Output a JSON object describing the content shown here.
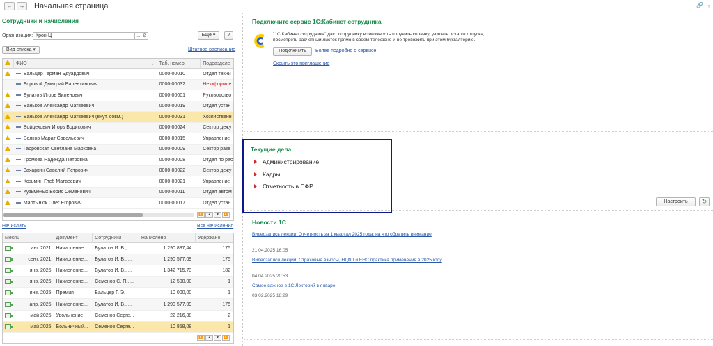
{
  "window": {
    "title": "Начальная страница",
    "back_icon": "arrow-left",
    "forward_icon": "arrow-right"
  },
  "employees": {
    "section_title": "Сотрудники и начисления",
    "org_label": "Организация:",
    "org_value": "Крон-Ц",
    "more_label": "Еще",
    "help_label": "?",
    "view_list_label": "Вид списка",
    "staff_schedule_link": "Штатное расписание",
    "columns": [
      "ФИО",
      "Таб. номер",
      "Подразделе"
    ],
    "rows": [
      {
        "name": "Бальцер Герман Эдуардович",
        "num": "0000-00010",
        "dept": "Отдел техни",
        "warn": true,
        "dept_red": false,
        "selected": false
      },
      {
        "name": "Боровой Дмитрий Валентинович",
        "num": "0000-00032",
        "dept": "Не оформле",
        "warn": false,
        "dept_red": true,
        "selected": false
      },
      {
        "name": "Булатов Игорь Виленович",
        "num": "0000-00001",
        "dept": "Руководство",
        "warn": true,
        "dept_red": false,
        "selected": false
      },
      {
        "name": "Ваньков Александр Матвеевич",
        "num": "0000-00019",
        "dept": "Отдел устан",
        "warn": true,
        "dept_red": false,
        "selected": false
      },
      {
        "name": "Ваньков Александр Матвеевич (внут. совм.)",
        "num": "0000-00031",
        "dept": "Хозяйственн",
        "warn": true,
        "dept_red": false,
        "selected": true
      },
      {
        "name": "Войцехович Игорь Борисович",
        "num": "0000-00024",
        "dept": "Сектор дежу",
        "warn": true,
        "dept_red": false,
        "selected": false
      },
      {
        "name": "Волков Марат Савельевич",
        "num": "0000-00015",
        "dept": "Управление",
        "warn": true,
        "dept_red": false,
        "selected": false
      },
      {
        "name": "Габровская Светлана Марковна",
        "num": "0000-00009",
        "dept": "Сектор разв",
        "warn": true,
        "dept_red": false,
        "selected": false
      },
      {
        "name": "Громова Надежда Петровна",
        "num": "0000-00008",
        "dept": "Отдел по раб",
        "warn": true,
        "dept_red": false,
        "selected": false
      },
      {
        "name": "Захаркин Савелий Петрович",
        "num": "0000-00022",
        "dept": "Сектор дежу",
        "warn": true,
        "dept_red": false,
        "selected": false
      },
      {
        "name": "Козьмин Глеб Матвеевич",
        "num": "0000-00021",
        "dept": "Управление",
        "warn": true,
        "dept_red": false,
        "selected": false
      },
      {
        "name": "Кузьменых Борис Семенович",
        "num": "0000-00011",
        "dept": "Отдел автом",
        "warn": true,
        "dept_red": false,
        "selected": false
      },
      {
        "name": "Мартынюк Олег Егорович",
        "num": "0000-00017",
        "dept": "Отдел устан",
        "warn": true,
        "dept_red": false,
        "selected": false
      }
    ]
  },
  "accruals": {
    "calc_link": "Начислить",
    "all_link": "Все начисления",
    "columns": [
      "Месяц",
      "Документ",
      "Сотрудники",
      "Начислено",
      "Удержано"
    ],
    "rows": [
      {
        "month": "авг. 2021",
        "doc": "Начисление...",
        "emp": "Булатов И. В., ...",
        "acc": "1 290 887,44",
        "ded": "175",
        "selected": false
      },
      {
        "month": "сент. 2021",
        "doc": "Начисление...",
        "emp": "Булатов И. В., ...",
        "acc": "1 290 577,09",
        "ded": "175",
        "selected": false
      },
      {
        "month": "янв. 2025",
        "doc": "Начисление...",
        "emp": "Булатов И. В., ...",
        "acc": "1 342 715,73",
        "ded": "182",
        "selected": false
      },
      {
        "month": "янв. 2025",
        "doc": "Начисление...",
        "emp": "Семенов С. П., ...",
        "acc": "12 500,00",
        "ded": "1",
        "selected": false
      },
      {
        "month": "янв. 2025",
        "doc": "Премия",
        "emp": "Бальцер Г. Э.",
        "acc": "10 000,00",
        "ded": "1",
        "selected": false
      },
      {
        "month": "апр. 2025",
        "doc": "Начисление...",
        "emp": "Булатов И. В., ...",
        "acc": "1 290 577,09",
        "ded": "175",
        "selected": false
      },
      {
        "month": "май 2025",
        "doc": "Увольнение",
        "emp": "Семенов Серге...",
        "acc": "22 216,88",
        "ded": "2",
        "selected": false
      },
      {
        "month": "май 2025",
        "doc": "Больничный...",
        "emp": "Семенов Серге...",
        "acc": "10 858,08",
        "ded": "1",
        "selected": true
      }
    ]
  },
  "cabinet": {
    "title": "Подключите сервис 1С:Кабинет сотрудника",
    "desc_line1": "\"1С:Кабинет сотрудника\" даст сотруднику возможность получить справку, увидеть остаток отпуска,",
    "desc_line2": "посмотреть расчетный листок прямо в своем телефоне и не тревожить при этом бухгалтерию.",
    "connect_label": "Подключить",
    "more_link": "Более подробно о сервисе",
    "hide_link": "Скрыть это приглашение"
  },
  "tasks": {
    "title": "Текущие дела",
    "items": [
      "Администрирование",
      "Кадры",
      "Отчетность в ПФР"
    ],
    "configure_label": "Настроить"
  },
  "news": {
    "title": "Новости 1С",
    "items": [
      {
        "text": "Видеозапись лекции: Отчетность за 1 квартал 2025 года: на что обратить внимание",
        "date": "21.04.2025 16:05"
      },
      {
        "text": "Видеозаписи лекции: Страховые взносы, НДФЛ и ЕНС практика применения в 2025 году",
        "date": "04.04.2025 20:53"
      },
      {
        "text": "Самое важное в 1С:Лекторий в январе",
        "date": "03.02.2025 18:29"
      }
    ]
  },
  "colors": {
    "accent_green": "#1a8c4e",
    "link_blue": "#2a57a8",
    "highlight_frame": "#0c1a8c",
    "selected_row": "#fbe7a9"
  }
}
